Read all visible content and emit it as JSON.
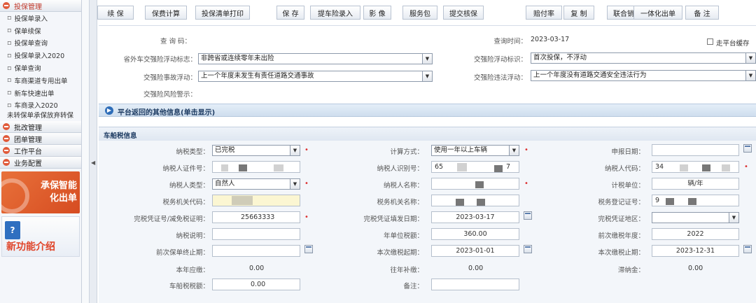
{
  "sidebar": {
    "sections": [
      {
        "label": "投保管理",
        "active": true
      },
      {
        "label": "批改管理"
      },
      {
        "label": "团单管理"
      },
      {
        "label": "工作平台"
      },
      {
        "label": "业务配置"
      }
    ],
    "items": [
      "投保单录入",
      "保单续保",
      "投保单查询",
      "投保单录入2020",
      "保单查询",
      "车商渠道专用出单",
      "新车快速出单",
      "车商录入2020",
      "未转保单承保放弃转保"
    ],
    "banner1": "承保智能化出单",
    "banner2": "新功能介绍"
  },
  "toolbar": {
    "buttons": [
      "续 保",
      "保费计算",
      "投保清单打印",
      "保 存",
      "提车险录入",
      "影 像",
      "服务包",
      "提交核保",
      "赔付率",
      "复 制",
      "联合销售",
      "一体化出单",
      "备 注"
    ]
  },
  "top_form": {
    "query_code_label": "查 询 码：",
    "query_time_label": "查询时间：",
    "query_time_value": "2023-03-17",
    "platform_cache_label": "走平台缓存",
    "float_flag_label": "省外车交强险浮动标志：",
    "float_flag_value": "非跨省或连续零年未出险",
    "float_reason_label": "交强险浮动标识：",
    "float_reason_value": "首次投保，不浮动",
    "accident_float_label": "交强险事故浮动：",
    "accident_float_value": "上一个年度未发生有责任道路交通事故",
    "violation_float_label": "交强险违法浮动：",
    "violation_float_value": "上一个年度没有道路交通安全违法行为",
    "risk_warning_label": "交强险风险警示："
  },
  "platform_info": "平台返回的其他信息(单击显示)",
  "tax": {
    "header": "车船税信息",
    "tax_type_label": "纳税类型：",
    "tax_type_value": "已完税",
    "calc_method_label": "计算方式：",
    "calc_method_value": "使用一年以上车辆",
    "declare_date_label": "申报日期：",
    "taxpayer_id_label": "纳税人证件号：",
    "taxpayer_recog_label": "纳税人识别号：",
    "taxpayer_recog_value_a": "65",
    "taxpayer_recog_value_b": "7",
    "taxpayer_code_label": "纳税人代码：",
    "taxpayer_code_value": "34",
    "taxpayer_type_label": "纳税人类型：",
    "taxpayer_type_value": "自然人",
    "taxpayer_name_label": "纳税人名称：",
    "tax_unit_label": "计税单位：",
    "tax_unit_value": "辆/年",
    "tax_office_code_label": "税务机关代码：",
    "tax_office_name_label": "税务机关名称：",
    "tax_reg_no_label": "税务登记证号：",
    "tax_reg_no_value": "9",
    "paid_cert_label": "完税凭证号/减免税证明：",
    "paid_cert_value": "25663333",
    "cert_date_label": "完税凭证填发日期：",
    "cert_date_value": "2023-03-17",
    "cert_region_label": "完税凭证地区：",
    "tax_note_label": "纳税说明：",
    "annual_tax_label": "年单位税额：",
    "annual_tax_value": "360.00",
    "prev_tax_year_label": "前次缴税年度：",
    "prev_tax_year_value": "2022",
    "prev_policy_end_label": "前次保单终止期：",
    "start_date_label": "本次缴税起期：",
    "start_date_value": "2023-01-01",
    "end_date_label": "本次缴税止期：",
    "end_date_value": "2023-12-31",
    "this_year_due_label": "本年应缴：",
    "this_year_due_value": "0.00",
    "prev_supp_label": "往年补缴：",
    "prev_supp_value": "0.00",
    "late_fee_label": "滞纳金：",
    "late_fee_value": "0.00",
    "vessel_tax_label": "车船税税额：",
    "vessel_tax_value": "0.00",
    "remark_label": "备注："
  }
}
